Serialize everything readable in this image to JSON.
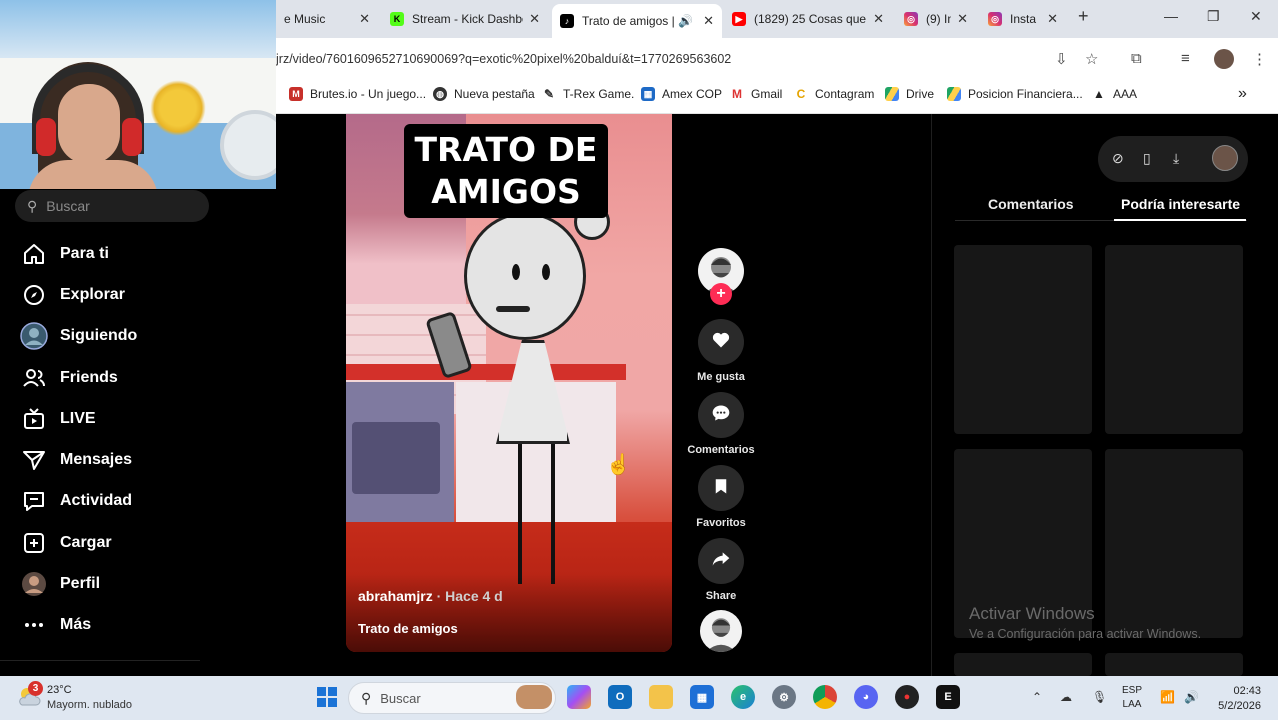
{
  "browser": {
    "tabs": [
      {
        "title": "e Music",
        "icon": "youtube-music-icon",
        "active": false
      },
      {
        "title": "Stream - Kick Dashbo",
        "icon": "kick-icon",
        "active": false
      },
      {
        "title": "Trato de amigos |",
        "icon": "tiktok-icon",
        "active": true
      },
      {
        "title": "(1829) 25 Cosas que",
        "icon": "youtube-icon",
        "active": false
      },
      {
        "title": "(9) In",
        "icon": "instagram-icon",
        "active": false
      },
      {
        "title": "Insta",
        "icon": "instagram-icon",
        "active": false
      }
    ],
    "new_tab": "+",
    "url": "jrz/video/7601609652710690069?q=exotic%20pixel%20balduí&t=1770269563602",
    "bookmarks": [
      {
        "label": "Brutes.io - Un juego...",
        "icon": "brutes-icon"
      },
      {
        "label": "Nueva pestaña",
        "icon": "globe-icon"
      },
      {
        "label": "T-Rex Game.",
        "icon": "trex-icon"
      },
      {
        "label": "Amex COP",
        "icon": "amex-icon"
      },
      {
        "label": "Gmail",
        "icon": "gmail-icon"
      },
      {
        "label": "Contagram",
        "icon": "contagram-icon"
      },
      {
        "label": "Drive",
        "icon": "drive-icon"
      },
      {
        "label": "Posicion Financiera...",
        "icon": "drive-icon"
      },
      {
        "label": "AAA",
        "icon": "aaa-icon"
      }
    ],
    "more_bookmarks": "»"
  },
  "sidebar": {
    "search_placeholder": "Buscar",
    "items": [
      {
        "label": "Para ti",
        "icon": "home-icon"
      },
      {
        "label": "Explorar",
        "icon": "compass-icon"
      },
      {
        "label": "Siguiendo",
        "icon": "following-avatar-icon"
      },
      {
        "label": "Friends",
        "icon": "friends-icon"
      },
      {
        "label": "LIVE",
        "icon": "live-tv-icon"
      },
      {
        "label": "Mensajes",
        "icon": "send-icon"
      },
      {
        "label": "Actividad",
        "icon": "activity-icon"
      },
      {
        "label": "Cargar",
        "icon": "upload-plus-icon"
      },
      {
        "label": "Perfil",
        "icon": "profile-avatar-icon"
      },
      {
        "label": "Más",
        "icon": "more-dots-icon"
      }
    ]
  },
  "video": {
    "overlay_title": "TRATO DE AMIGOS",
    "author": "abrahamjrz",
    "age": "· Hace 4 d",
    "caption": "Trato de amigos"
  },
  "actions": {
    "like_label": "Me gusta",
    "comments_label": "Comentarios",
    "favorites_label": "Favoritos",
    "share_label": "Share"
  },
  "right_panel": {
    "tabs": [
      "Comentarios",
      "Podría interesarte"
    ],
    "active_tab": "Podría interesarte"
  },
  "watermark": {
    "line1": "Activar Windows",
    "line2": "Ve a Configuración para activar Windows."
  },
  "taskbar": {
    "weather_badge": "3",
    "temperature": "23°C",
    "weather_desc": "Mayorm. nublado",
    "search_placeholder": "Buscar",
    "lang_line1": "ESP",
    "lang_line2": "LAA",
    "time": "02:43",
    "date": "5/2/2026"
  },
  "colors": {
    "tiktok_accent": "#fe2c55",
    "page_bg": "#000000",
    "tab_strip": "#dfe3ea",
    "taskbar_bg": "#dfe7f1"
  }
}
